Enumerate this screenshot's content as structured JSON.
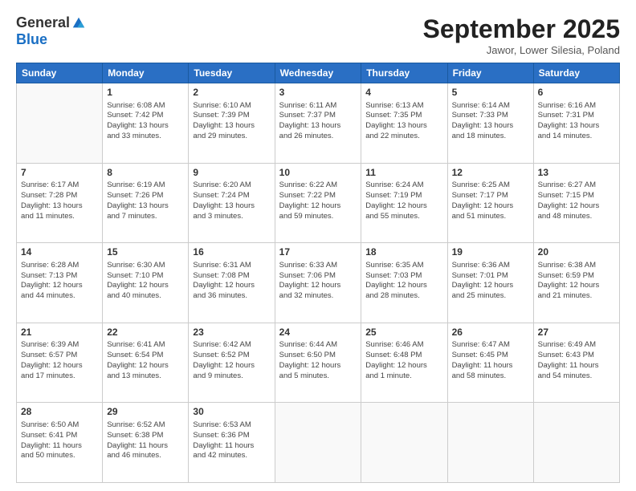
{
  "logo": {
    "general": "General",
    "blue": "Blue"
  },
  "title": "September 2025",
  "subtitle": "Jawor, Lower Silesia, Poland",
  "days_header": [
    "Sunday",
    "Monday",
    "Tuesday",
    "Wednesday",
    "Thursday",
    "Friday",
    "Saturday"
  ],
  "weeks": [
    [
      {
        "day": "",
        "info": ""
      },
      {
        "day": "1",
        "info": "Sunrise: 6:08 AM\nSunset: 7:42 PM\nDaylight: 13 hours\nand 33 minutes."
      },
      {
        "day": "2",
        "info": "Sunrise: 6:10 AM\nSunset: 7:39 PM\nDaylight: 13 hours\nand 29 minutes."
      },
      {
        "day": "3",
        "info": "Sunrise: 6:11 AM\nSunset: 7:37 PM\nDaylight: 13 hours\nand 26 minutes."
      },
      {
        "day": "4",
        "info": "Sunrise: 6:13 AM\nSunset: 7:35 PM\nDaylight: 13 hours\nand 22 minutes."
      },
      {
        "day": "5",
        "info": "Sunrise: 6:14 AM\nSunset: 7:33 PM\nDaylight: 13 hours\nand 18 minutes."
      },
      {
        "day": "6",
        "info": "Sunrise: 6:16 AM\nSunset: 7:31 PM\nDaylight: 13 hours\nand 14 minutes."
      }
    ],
    [
      {
        "day": "7",
        "info": "Sunrise: 6:17 AM\nSunset: 7:28 PM\nDaylight: 13 hours\nand 11 minutes."
      },
      {
        "day": "8",
        "info": "Sunrise: 6:19 AM\nSunset: 7:26 PM\nDaylight: 13 hours\nand 7 minutes."
      },
      {
        "day": "9",
        "info": "Sunrise: 6:20 AM\nSunset: 7:24 PM\nDaylight: 13 hours\nand 3 minutes."
      },
      {
        "day": "10",
        "info": "Sunrise: 6:22 AM\nSunset: 7:22 PM\nDaylight: 12 hours\nand 59 minutes."
      },
      {
        "day": "11",
        "info": "Sunrise: 6:24 AM\nSunset: 7:19 PM\nDaylight: 12 hours\nand 55 minutes."
      },
      {
        "day": "12",
        "info": "Sunrise: 6:25 AM\nSunset: 7:17 PM\nDaylight: 12 hours\nand 51 minutes."
      },
      {
        "day": "13",
        "info": "Sunrise: 6:27 AM\nSunset: 7:15 PM\nDaylight: 12 hours\nand 48 minutes."
      }
    ],
    [
      {
        "day": "14",
        "info": "Sunrise: 6:28 AM\nSunset: 7:13 PM\nDaylight: 12 hours\nand 44 minutes."
      },
      {
        "day": "15",
        "info": "Sunrise: 6:30 AM\nSunset: 7:10 PM\nDaylight: 12 hours\nand 40 minutes."
      },
      {
        "day": "16",
        "info": "Sunrise: 6:31 AM\nSunset: 7:08 PM\nDaylight: 12 hours\nand 36 minutes."
      },
      {
        "day": "17",
        "info": "Sunrise: 6:33 AM\nSunset: 7:06 PM\nDaylight: 12 hours\nand 32 minutes."
      },
      {
        "day": "18",
        "info": "Sunrise: 6:35 AM\nSunset: 7:03 PM\nDaylight: 12 hours\nand 28 minutes."
      },
      {
        "day": "19",
        "info": "Sunrise: 6:36 AM\nSunset: 7:01 PM\nDaylight: 12 hours\nand 25 minutes."
      },
      {
        "day": "20",
        "info": "Sunrise: 6:38 AM\nSunset: 6:59 PM\nDaylight: 12 hours\nand 21 minutes."
      }
    ],
    [
      {
        "day": "21",
        "info": "Sunrise: 6:39 AM\nSunset: 6:57 PM\nDaylight: 12 hours\nand 17 minutes."
      },
      {
        "day": "22",
        "info": "Sunrise: 6:41 AM\nSunset: 6:54 PM\nDaylight: 12 hours\nand 13 minutes."
      },
      {
        "day": "23",
        "info": "Sunrise: 6:42 AM\nSunset: 6:52 PM\nDaylight: 12 hours\nand 9 minutes."
      },
      {
        "day": "24",
        "info": "Sunrise: 6:44 AM\nSunset: 6:50 PM\nDaylight: 12 hours\nand 5 minutes."
      },
      {
        "day": "25",
        "info": "Sunrise: 6:46 AM\nSunset: 6:48 PM\nDaylight: 12 hours\nand 1 minute."
      },
      {
        "day": "26",
        "info": "Sunrise: 6:47 AM\nSunset: 6:45 PM\nDaylight: 11 hours\nand 58 minutes."
      },
      {
        "day": "27",
        "info": "Sunrise: 6:49 AM\nSunset: 6:43 PM\nDaylight: 11 hours\nand 54 minutes."
      }
    ],
    [
      {
        "day": "28",
        "info": "Sunrise: 6:50 AM\nSunset: 6:41 PM\nDaylight: 11 hours\nand 50 minutes."
      },
      {
        "day": "29",
        "info": "Sunrise: 6:52 AM\nSunset: 6:38 PM\nDaylight: 11 hours\nand 46 minutes."
      },
      {
        "day": "30",
        "info": "Sunrise: 6:53 AM\nSunset: 6:36 PM\nDaylight: 11 hours\nand 42 minutes."
      },
      {
        "day": "",
        "info": ""
      },
      {
        "day": "",
        "info": ""
      },
      {
        "day": "",
        "info": ""
      },
      {
        "day": "",
        "info": ""
      }
    ]
  ]
}
